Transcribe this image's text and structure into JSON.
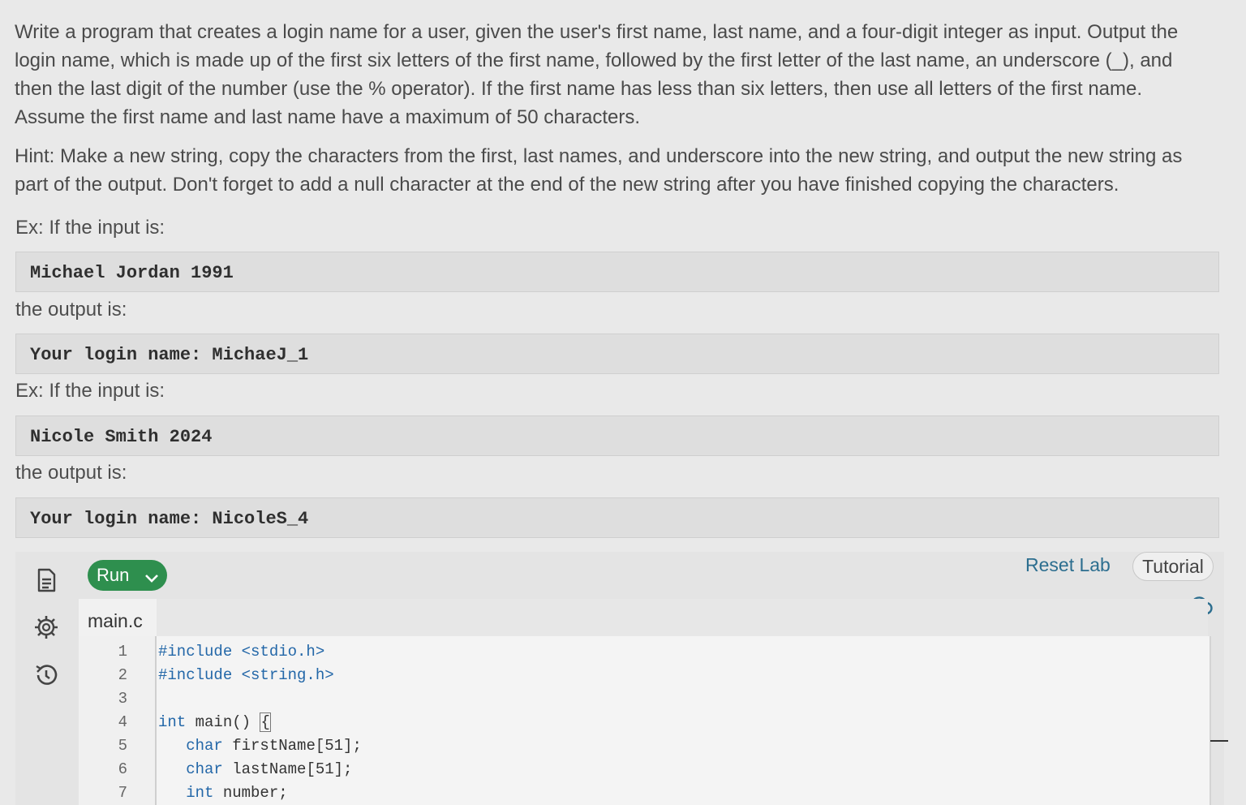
{
  "description": {
    "p1": "Write a program that creates a login name for a user, given the user's first name, last name, and a four-digit integer as input. Output the login name, which is made up of the first six letters of the first name, followed by the first letter of the last name, an underscore (_), and then the last digit of the number (use the % operator). If the first name has less than six letters, then use all letters of the first name. Assume the first name and last name have a maximum of 50 characters.",
    "p2": "Hint: Make a new string, copy the characters from the first, last names, and underscore into the new string, and output the new string as part of the output. Don't forget to add a null character at the end of the new string after you have finished copying the characters."
  },
  "examples": [
    {
      "input_label": "Ex: If the input is:",
      "input": "Michael Jordan 1991",
      "output_label": "the output is:",
      "output": "Your login name: MichaeJ_1"
    },
    {
      "input_label": "Ex: If the input is:",
      "input": "Nicole Smith 2024",
      "output_label": "the output is:",
      "output": "Your login name: NicoleS_4"
    }
  ],
  "toolbar": {
    "run_label": "Run",
    "reset_label": "Reset Lab",
    "tutorial_label": "Tutorial"
  },
  "icons": {
    "file": "file-icon",
    "settings": "gear-icon",
    "history": "history-icon",
    "cloud": "cloud-check-icon",
    "run_menu": "chevron-down-icon"
  },
  "editor": {
    "filename": "main.c",
    "lines": [
      {
        "num": "1",
        "parts": [
          {
            "t": "#include <stdio.h>",
            "c": "kw"
          }
        ]
      },
      {
        "num": "2",
        "parts": [
          {
            "t": "#include <string.h>",
            "c": "kw"
          }
        ]
      },
      {
        "num": "3",
        "parts": []
      },
      {
        "num": "4",
        "parts": [
          {
            "t": "int",
            "c": "kw"
          },
          {
            "t": " main() ",
            "c": ""
          },
          {
            "t": "{",
            "c": "cursor"
          }
        ]
      },
      {
        "num": "5",
        "parts": [
          {
            "t": "   char",
            "c": "kw"
          },
          {
            "t": " firstName[51];",
            "c": ""
          }
        ]
      },
      {
        "num": "6",
        "parts": [
          {
            "t": "   char",
            "c": "kw"
          },
          {
            "t": " lastName[51];",
            "c": ""
          }
        ]
      },
      {
        "num": "7",
        "parts": [
          {
            "t": "   int",
            "c": "kw"
          },
          {
            "t": " number;",
            "c": ""
          }
        ]
      }
    ]
  },
  "colors": {
    "run_button": "#2e8f4e",
    "reset_link": "#2c6e8f",
    "keyword": "#2367a8"
  }
}
